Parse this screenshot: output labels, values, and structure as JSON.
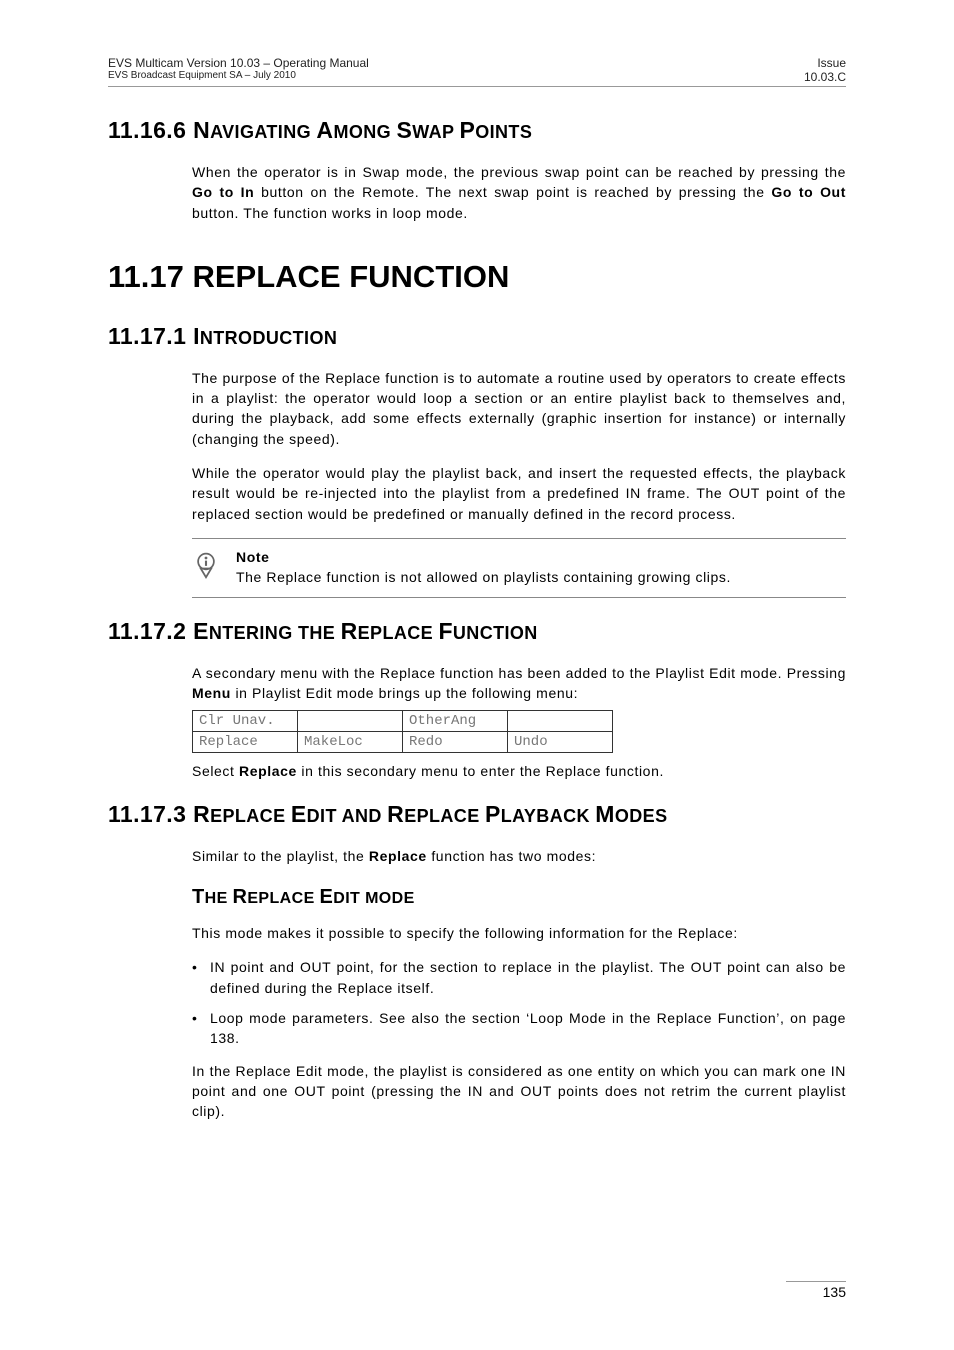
{
  "header": {
    "left_line1": "EVS Multicam Version 10.03  – Operating Manual",
    "left_line2": "EVS Broadcast Equipment SA – July 2010",
    "right_line1": "Issue",
    "right_line2": "10.03.C"
  },
  "sec_11_16_6": {
    "num": "11.16.6 ",
    "title_caps": "N",
    "title_rest_1": "AVIGATING ",
    "title_caps2": "A",
    "title_rest_2": "MONG ",
    "title_caps3": "S",
    "title_rest_3": "WAP ",
    "title_caps4": "P",
    "title_rest_4": "OINTS",
    "p1_a": "When the operator is in Swap mode, the previous swap point can be reached by pressing the ",
    "p1_b": "Go to In",
    "p1_c": " button on the Remote. The next swap point is reached by pressing the ",
    "p1_d": "Go to Out",
    "p1_e": " button. The function works in loop mode."
  },
  "sec_11_17": {
    "title": "11.17 REPLACE FUNCTION"
  },
  "sec_11_17_1": {
    "num": "11.17.1 ",
    "t1": "I",
    "t2": "NTRODUCTION",
    "p1": "The purpose of the Replace function is to automate a routine used by operators to create effects in a playlist: the operator would loop a section or an entire playlist back to themselves and, during the playback, add some effects externally (graphic insertion for instance) or internally (changing the speed).",
    "p2": "While the operator would play the playlist back, and insert the requested effects, the playback result would be re-injected into the playlist from a predefined IN frame. The OUT point of the replaced section would be predefined or manually defined in the record process.",
    "note_title": "Note",
    "note_body": "The Replace function is not allowed on playlists containing growing clips."
  },
  "sec_11_17_2": {
    "num": "11.17.2 ",
    "t1": "E",
    "t2": "NTERING THE ",
    "t3": "R",
    "t4": "EPLACE ",
    "t5": "F",
    "t6": "UNCTION",
    "p1_a": "A secondary menu with the Replace function has been added to the Playlist Edit mode. Pressing ",
    "p1_b": "Menu",
    "p1_c": " in Playlist Edit mode brings up the following menu:",
    "table": {
      "r1c1": "Clr Unav.",
      "r1c2": "",
      "r1c3": "OtherAng",
      "r1c4": "",
      "r2c1": "Replace",
      "r2c2": "MakeLoc",
      "r2c3": "Redo",
      "r2c4": "Undo"
    },
    "p2_a": "Select ",
    "p2_b": "Replace",
    "p2_c": " in this secondary menu to enter the Replace function."
  },
  "sec_11_17_3": {
    "num": "11.17.3 ",
    "t1": "R",
    "t2": "EPLACE ",
    "t3": "E",
    "t4": "DIT AND ",
    "t5": "R",
    "t6": "EPLACE ",
    "t7": "P",
    "t8": "LAYBACK ",
    "t9": "M",
    "t10": "ODES",
    "p1_a": "Similar to the playlist, the ",
    "p1_b": "Replace",
    "p1_c": " function has two modes:",
    "sub_t1": "T",
    "sub_t2": "HE ",
    "sub_t3": "R",
    "sub_t4": "EPLACE ",
    "sub_t5": "E",
    "sub_t6": "DIT MODE",
    "p2": "This mode makes it possible to specify the following information for the Replace:",
    "b1": "IN point and OUT point, for the section to replace in the playlist. The OUT point can also be defined during the Replace itself.",
    "b2": "Loop mode parameters. See also the section ‘Loop Mode in the Replace Function’, on page 138.",
    "p3": "In the Replace Edit mode, the playlist is considered as one entity on which you can mark one IN point and one OUT point (pressing the IN and OUT points does not retrim the current playlist clip)."
  },
  "footer": {
    "page": "135"
  }
}
